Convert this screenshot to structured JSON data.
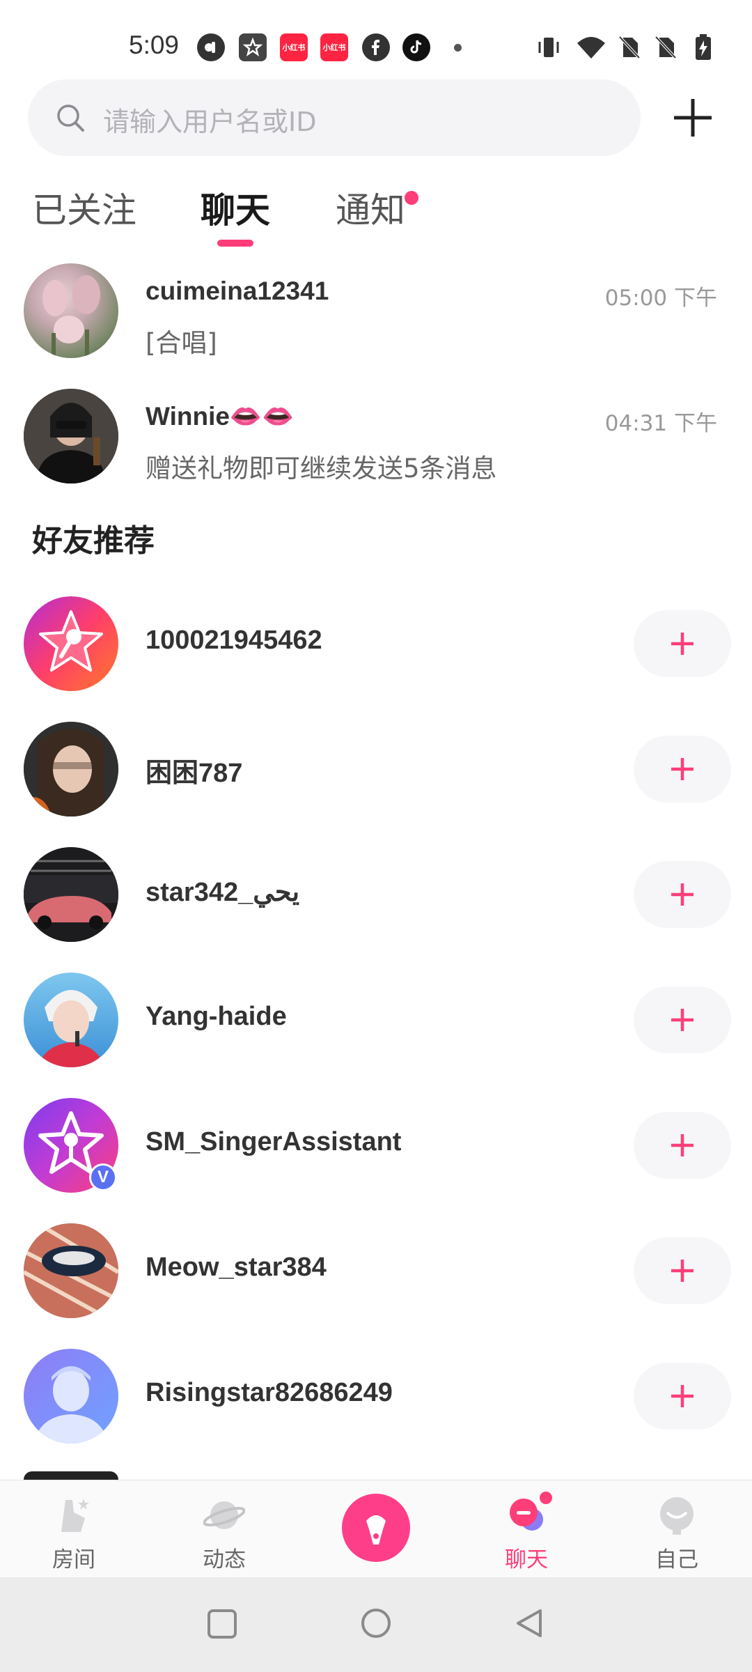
{
  "status_bar": {
    "time": "5:09",
    "notification_icons": [
      "tiktok-alt-icon",
      "star-badge-icon",
      "xiaohongshu-icon",
      "xiaohongshu-icon",
      "facebook-icon",
      "tiktok-icon"
    ],
    "system_icons": [
      "vibrate-icon",
      "wifi-icon",
      "no-sim-icon",
      "no-sim-icon",
      "battery-charging-icon"
    ],
    "xhs_label": "小红书"
  },
  "search": {
    "placeholder": "请输入用户名或ID"
  },
  "tabs": [
    {
      "label": "已关注",
      "active": false
    },
    {
      "label": "聊天",
      "active": true
    },
    {
      "label": "通知",
      "active": false,
      "has_dot": true
    }
  ],
  "chats": [
    {
      "name": "cuimeina12341",
      "message": "[合唱]",
      "time": "05:00 下午"
    },
    {
      "name": "Winnie👄👄",
      "message": "赠送礼物即可继续发送5条消息",
      "time": "04:31 下午"
    }
  ],
  "recommend_title": "好友推荐",
  "recommendations": [
    {
      "name": "100021945462"
    },
    {
      "name": "困困787"
    },
    {
      "name": "star342_يحي"
    },
    {
      "name": "Yang-haide"
    },
    {
      "name": "SM_SingerAssistant",
      "verified": true,
      "verified_label": "V"
    },
    {
      "name": "Meow_star384"
    },
    {
      "name": "Risingstar82686249"
    }
  ],
  "bottom_nav": [
    {
      "label": "房间",
      "icon": "room-icon",
      "active": false
    },
    {
      "label": "动态",
      "icon": "planet-icon",
      "active": false
    },
    {
      "label": "",
      "icon": "microphone-icon",
      "active": false
    },
    {
      "label": "聊天",
      "icon": "chat-bubble-icon",
      "active": true,
      "badge": true
    },
    {
      "label": "自己",
      "icon": "profile-icon",
      "active": false
    }
  ],
  "colors": {
    "accent": "#ff3e79",
    "text_primary": "#333333",
    "text_secondary": "#999999",
    "search_bg": "#f4f4f6"
  }
}
